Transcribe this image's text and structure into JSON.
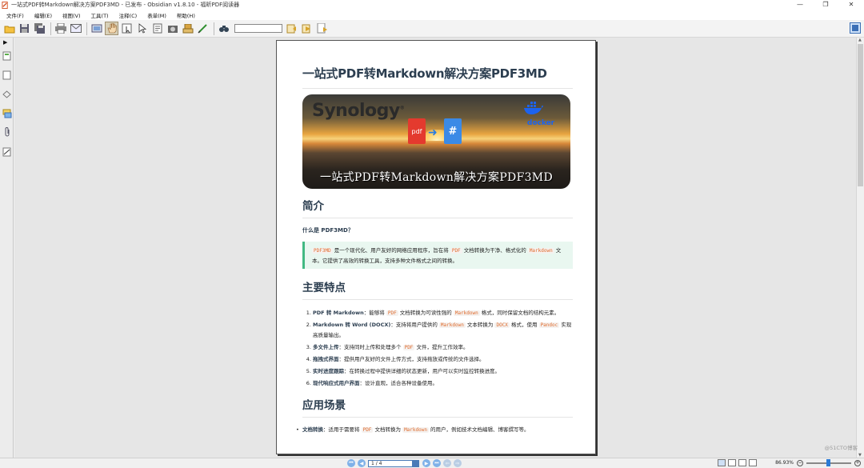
{
  "window": {
    "title": "一站式PDF转Markdown解决方案PDF3MD - 已发布 - Obsidian v1.8.10 - 福昕PDF阅读器",
    "controls": [
      "minimize",
      "restore",
      "close"
    ]
  },
  "menu": [
    "文件(F)",
    "编辑(E)",
    "视图(V)",
    "工具(T)",
    "注释(C)",
    "表单(M)",
    "帮助(H)"
  ],
  "toolbar": {
    "search_value": "",
    "icons": [
      "open-folder-icon",
      "save-icon",
      "save-all-icon",
      "print-icon",
      "email-icon",
      "scan-icon",
      "hand-tool-icon",
      "select-tool-icon",
      "pointer-icon",
      "text-select-icon",
      "snapshot-icon",
      "stamp-icon",
      "sign-icon",
      "find-icon",
      "search-prev-icon",
      "search-next-icon",
      "bookmark-icon"
    ]
  },
  "left_panel": {
    "icons": [
      "pages-icon",
      "bookmarks-icon",
      "layers-icon",
      "comments-icon",
      "attachments-icon",
      "signatures-icon"
    ]
  },
  "document": {
    "title": "一站式PDF转Markdown解决方案PDF3MD",
    "banner": {
      "brand_left": "Synology",
      "pdf_label": "pdf",
      "md_label": "#",
      "brand_right": "docker",
      "caption": "一站式PDF转Markdown解决方案PDF3MD"
    },
    "intro": {
      "heading": "简介",
      "question": "什么是 PDF3MD？",
      "quote": {
        "code1": "PDF3MD",
        "text1": " 是一个现代化、用户友好的网络应用程序，旨在将 ",
        "code2": "PDF",
        "text2": " 文档转换为干净、格式化的 ",
        "code3": "Markdown",
        "text3": " 文本。它提供了高效的转换工具，支持多种文件格式之间的转换。"
      }
    },
    "features": {
      "heading": "主要特点",
      "items": [
        {
          "title": "PDF 转 Markdown",
          "t1": "：能够将 ",
          "c1": "PDF",
          "t2": " 文档转换为可读性强的 ",
          "c2": "Markdown",
          "t3": " 格式，同时保留文档的结构元素。"
        },
        {
          "title": "Markdown 转 Word (DOCX)",
          "t1": "：支持将用户提供的 ",
          "c1": "Markdown",
          "t2": " 文本转换为 ",
          "c2": "DOCX",
          "t3": " 格式，使用 ",
          "c3": "Pandoc",
          "t4": " 实现高质量输出。"
        },
        {
          "title": "多文件上传",
          "t1": "：支持同时上传和处理多个 ",
          "c1": "PDF",
          "t2": " 文件，提升工作效率。"
        },
        {
          "title": "拖拽式界面",
          "t1": "：提供用户友好的文件上传方式，支持拖放或传统的文件选择。"
        },
        {
          "title": "实时进度跟踪",
          "t1": "：在转换过程中提供详细的状态更新，用户可以实时监控转换进度。"
        },
        {
          "title": "现代响应式用户界面",
          "t1": "：设计直观，适合各种设备使用。"
        }
      ]
    },
    "scenes": {
      "heading": "应用场景",
      "items": [
        {
          "title": "文档转换",
          "t1": "：适用于需要将 ",
          "c1": "PDF",
          "t2": " 文档转换为 ",
          "c2": "Markdown",
          "t3": " 的用户，例如技术文档编辑、博客撰写等。"
        }
      ]
    }
  },
  "statusbar": {
    "page": "1 / 4",
    "zoom": "86.93%",
    "zoom_out": "−",
    "zoom_in": "+"
  },
  "watermark": "@51CTO博客"
}
